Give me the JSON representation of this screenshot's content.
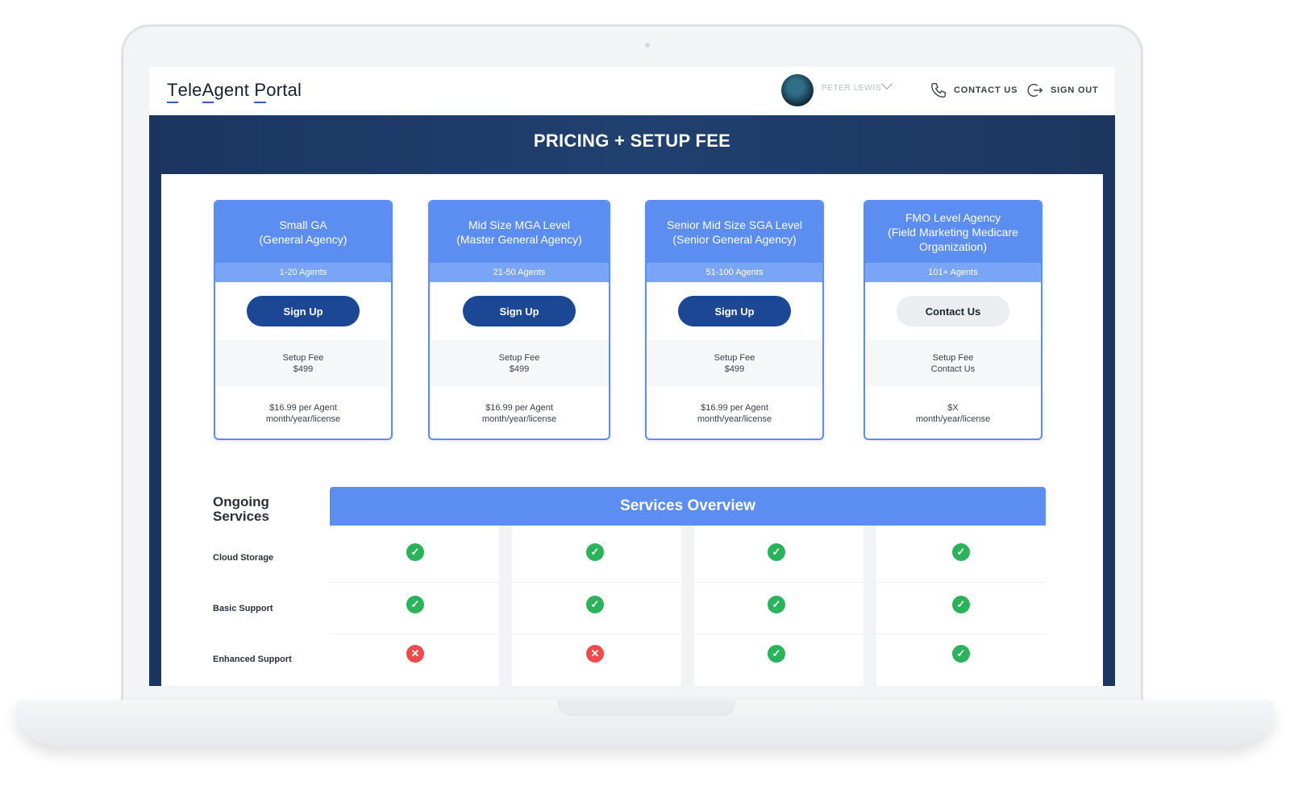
{
  "header": {
    "logo_parts": [
      "T",
      "ele",
      "A",
      "gent ",
      "P",
      "ortal"
    ],
    "user_name": "PETER LEWIS",
    "contact_label": "CONTACT US",
    "signout_label": "SIGN OUT"
  },
  "banner": {
    "title": "PRICING + SETUP FEE"
  },
  "plans": [
    {
      "name_line1": "Small GA",
      "name_line2": "(General Agency)",
      "name_line3": "",
      "agents": "1-20 Agents",
      "button": "Sign Up",
      "button_style": "primary",
      "fee_label": "Setup Fee",
      "fee_value": "$499",
      "price_line1": "$16.99 per Agent",
      "price_line2": "month/year/license"
    },
    {
      "name_line1": "Mid Size MGA Level",
      "name_line2": "(Master General Agency)",
      "name_line3": "",
      "agents": "21-50 Agents",
      "button": "Sign Up",
      "button_style": "primary",
      "fee_label": "Setup Fee",
      "fee_value": "$499",
      "price_line1": "$16.99 per Agent",
      "price_line2": "month/year/license"
    },
    {
      "name_line1": "Senior Mid Size  SGA Level",
      "name_line2": "(Senior General Agency)",
      "name_line3": "",
      "agents": "51-100 Agents",
      "button": "Sign Up",
      "button_style": "primary",
      "fee_label": "Setup Fee",
      "fee_value": "$499",
      "price_line1": "$16.99 per Agent",
      "price_line2": "month/year/license"
    },
    {
      "name_line1": "FMO  Level Agency",
      "name_line2": "(Field Marketing Medicare",
      "name_line3": "Organization)",
      "agents": "101+ Agents",
      "button": "Contact Us",
      "button_style": "gray",
      "fee_label": "Setup Fee",
      "fee_value": "Contact Us",
      "price_line1": "$X",
      "price_line2": "month/year/license"
    }
  ],
  "services": {
    "section_title_line1": "Ongoing",
    "section_title_line2": "Services",
    "overview_title": "Services Overview",
    "rows": [
      {
        "label": "Cloud Storage",
        "marks": [
          "check",
          "check",
          "check",
          "check"
        ]
      },
      {
        "label": "Basic Support",
        "marks": [
          "check",
          "check",
          "check",
          "check"
        ]
      },
      {
        "label": "Enhanced Support",
        "marks": [
          "cross",
          "cross",
          "check",
          "check"
        ]
      }
    ]
  },
  "icons": {
    "check": "check-icon",
    "cross": "cross-icon",
    "phone": "phone-icon",
    "signout": "sign-out-icon",
    "chevron": "chevron-down-icon"
  },
  "colors": {
    "navy": "#1b3560",
    "accent_blue": "#5b8ef0",
    "button_blue": "#1b4794",
    "check_green": "#2bb35b",
    "cross_red": "#ee4c4c"
  }
}
